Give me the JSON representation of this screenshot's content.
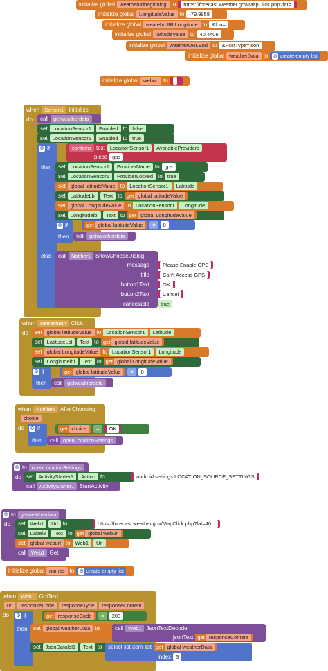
{
  "globals": {
    "init": "initialize global",
    "to": "to",
    "weatherurlbeginning": {
      "name": "weatherurlbeginning",
      "value": "https://forecast.weather.gov/MapClick.php?lat="
    },
    "longitudeValue": {
      "name": "LongitudeValue",
      "value": "-79.9958"
    },
    "weathrURLLongitude": {
      "name": "weatehrURLLongitude",
      "value": "&lon="
    },
    "latitudeValue": {
      "name": "latitudeValue",
      "value": "40.4406"
    },
    "weatherURLEnd": {
      "name": "weatherURLEnd",
      "value": "&FcstType=json"
    },
    "weatherData": {
      "name": "weatherData",
      "value": "create empty list"
    },
    "weburl": {
      "name": "weburl",
      "value": ""
    },
    "names": {
      "name": "names",
      "value": "create empty list"
    }
  },
  "screen_init": {
    "when": "when",
    "component": "Screen1",
    "event": "Initialize",
    "do": "do",
    "call": "call",
    "proc": "getweatherdata",
    "set": "set",
    "sensor": "LocationSensor1",
    "enabled": "Enabled",
    "to": "to",
    "false": "false",
    "true": "true",
    "if": "if",
    "contains": "contains",
    "text": "text",
    "available": "AvailableProviders",
    "piece": "piece",
    "gps": "gps",
    "then": "then",
    "providerName": "ProviderName",
    "providerLocked": "ProviderLocked",
    "global_lat": "global latitudeValue",
    "latitude": "Latitude",
    "latLbl": "LatitudeLbl",
    "textProp": "Text",
    "get": "get",
    "global_lon": "global LongitudeValue",
    "longitude": "Longitude",
    "lonLbl": "Longitudelbl",
    "neq": "≠",
    "zero": "0",
    "else": "else",
    "notifier": "Notifier1",
    "showChoose": "ShowChooseDialog",
    "message": "message",
    "msgVal": "Please Enable GPS",
    "title": "title",
    "titleVal": "Can't Access GPS",
    "b1": "button1Text",
    "ok": "OK",
    "b2": "button2Text",
    "cancel": "Cancel",
    "cancelable": "cancelable"
  },
  "refresh": {
    "component": "RefreshBtn",
    "event": "Click"
  },
  "after": {
    "component": "Notifier1",
    "event": "AfterChoosing",
    "param": "choice",
    "get_choice": "choice",
    "eq": "=",
    "ok": "OK",
    "proc": "openLocationSettings"
  },
  "open_settings": {
    "label": "to",
    "name": "openLocationSettings",
    "starter": "ActivityStarter1",
    "action": "Action",
    "action_val": "android.settings.LOCATION_SOURCE_SETTINGS",
    "start": "StartActivity"
  },
  "getweather": {
    "label": "to",
    "name": "getweatherdata",
    "web": "Web1",
    "url": "Url",
    "url_val": "https://forecast.weather.gov/MapClick.php?lat=40...",
    "label3": "Label3",
    "weburl": "global weburl",
    "get": "Get"
  },
  "gottext": {
    "component": "Web1",
    "event": "GotText",
    "params": [
      "url",
      "responseCode",
      "responseType",
      "responseContent"
    ],
    "get_rc": "responseCode",
    "eq": "=",
    "code": "200",
    "weatherData": "global weatherData",
    "jsonDecode": "JsonTextDecode",
    "jsonText": "jsonText",
    "responseContent": "responseContent",
    "jsonLbl": "JsonDatalbl1",
    "select": "select list item",
    "list": "list",
    "index": "index",
    "three": "3"
  }
}
